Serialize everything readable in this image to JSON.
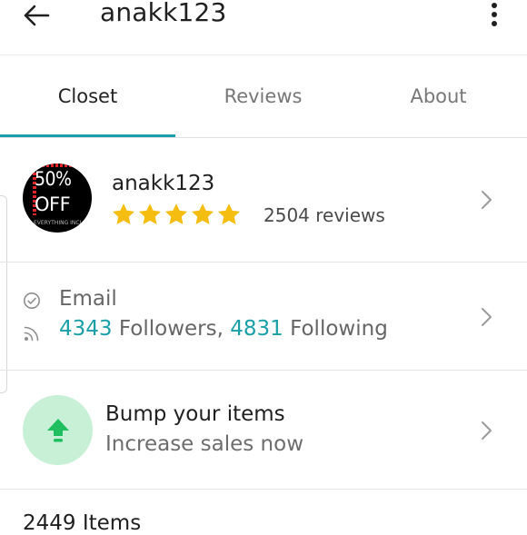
{
  "header": {
    "title": "anakk123",
    "back_icon": "arrow-left-icon",
    "more_icon": "more-vertical-icon"
  },
  "tabs": [
    {
      "label": "Closet",
      "active": true
    },
    {
      "label": "Reviews",
      "active": false
    },
    {
      "label": "About",
      "active": false
    }
  ],
  "profile": {
    "avatar": {
      "line1": "50%",
      "line2": "OFF",
      "small_text": "EVERYTHING INCL"
    },
    "username": "anakk123",
    "rating_stars": 5,
    "review_count": "2504 reviews"
  },
  "social": {
    "email_label": "Email",
    "followers_count": "4343",
    "followers_text": " Followers, ",
    "following_count": "4831",
    "following_text": " Following"
  },
  "bump": {
    "title": "Bump your items",
    "subtitle": "Increase sales now",
    "icon": "arrow-up-icon"
  },
  "items": {
    "count_label": "2449 Items"
  },
  "colors": {
    "accent_teal": "#1a9fa8",
    "star_yellow": "#f5bd10",
    "bump_bg": "#c8f0d7",
    "bump_green": "#1fbf5f"
  }
}
